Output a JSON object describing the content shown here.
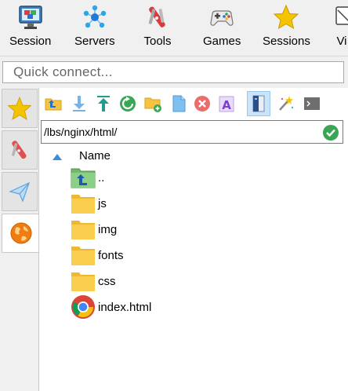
{
  "ribbon": {
    "items": [
      {
        "label": "Session",
        "icon": "session-icon"
      },
      {
        "label": "Servers",
        "icon": "servers-icon"
      },
      {
        "label": "Tools",
        "icon": "tools-icon"
      },
      {
        "label": "Games",
        "icon": "games-icon"
      },
      {
        "label": "Sessions",
        "icon": "sessions-star-icon"
      },
      {
        "label": "Vi",
        "icon": "view-icon"
      }
    ]
  },
  "quick_connect": {
    "placeholder": "Quick connect...",
    "value": ""
  },
  "side_tabs": [
    {
      "icon": "star-icon",
      "active": false
    },
    {
      "icon": "tools-icon",
      "active": false
    },
    {
      "icon": "paper-plane-icon",
      "active": false
    },
    {
      "icon": "sftp-globe-icon",
      "active": true
    }
  ],
  "file_toolbar": {
    "buttons": [
      {
        "icon": "parent-folder-icon"
      },
      {
        "icon": "download-icon"
      },
      {
        "icon": "upload-icon"
      },
      {
        "icon": "refresh-icon"
      },
      {
        "icon": "new-folder-icon"
      },
      {
        "icon": "new-file-icon"
      },
      {
        "icon": "delete-icon"
      },
      {
        "icon": "rename-icon"
      },
      {
        "icon": "toggle-panel-icon",
        "pressed": true
      },
      {
        "icon": "magic-wand-icon"
      },
      {
        "icon": "terminal-icon"
      }
    ]
  },
  "path_bar": {
    "value": "/lbs/nginx/html/"
  },
  "file_list": {
    "column_name": "Name",
    "sort": "ascending",
    "items": [
      {
        "name": "..",
        "type": "parent-folder"
      },
      {
        "name": "js",
        "type": "folder"
      },
      {
        "name": "img",
        "type": "folder"
      },
      {
        "name": "fonts",
        "type": "folder"
      },
      {
        "name": "css",
        "type": "folder"
      },
      {
        "name": "index.html",
        "type": "html-file"
      }
    ]
  },
  "colors": {
    "accent": "#2e8bd8",
    "folder": "#f6c43e",
    "ok_green": "#3aa655",
    "delete_red": "#e05a5a"
  }
}
